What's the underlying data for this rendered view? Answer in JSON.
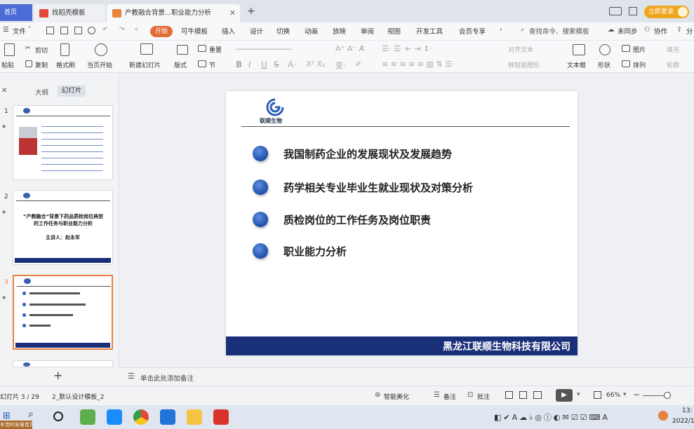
{
  "tabs": {
    "home": "首页",
    "tab1": "找稻壳模板",
    "tab2": "产教融合背景...职业能力分析",
    "new": "+",
    "login": "立即登录"
  },
  "menu": {
    "file": "文件",
    "start": "开始",
    "items": [
      "可牛模板",
      "插入",
      "设计",
      "切换",
      "动画",
      "放映",
      "审阅",
      "视图",
      "开发工具",
      "会员专享"
    ],
    "search": "查找命令、搜索模板",
    "sync": "未同步",
    "collab": "协作",
    "share": "分"
  },
  "ribbon": {
    "paste": "粘贴",
    "cut": "剪切",
    "copy": "复制",
    "format_painter": "格式刷",
    "play_current": "当页开始",
    "new_slide": "新建幻灯片",
    "layout": "版式",
    "section": "节",
    "reset": "重置",
    "align_text": "对齐文本",
    "smart_graphic": "转智能图形",
    "textbox": "文本框",
    "shape": "形状",
    "picture": "图片",
    "arrange": "排列",
    "fill": "填充",
    "outline": "轮廓"
  },
  "sidebar": {
    "outline_tab": "大纲",
    "slides_tab": "幻灯片",
    "add": "+",
    "slide2_title": "“产教融合”背景下药品质检岗位典型的工作任务与职业能力分析",
    "slide2_speaker": "主讲人：赵永军",
    "slide_numbers": [
      "1",
      "2",
      "3"
    ]
  },
  "slide": {
    "logo_text": "联顺生物",
    "bullets": [
      "我国制药企业的发展现状及发展趋势",
      "药学相关专业毕业生就业现状及对策分析",
      "质检岗位的工作任务及岗位职责",
      "职业能力分析"
    ],
    "footer": "黑龙江联顺生物科技有限公司"
  },
  "notes": {
    "placeholder": "单击此处添加备注"
  },
  "status": {
    "slide_counter": "幻灯片 3 / 29",
    "template": "2_默认设计模板_2",
    "beautify": "智能美化",
    "notes_btn": "备注",
    "comments_btn": "批注",
    "zoom": "66%"
  },
  "taskbar": {
    "time": "13:",
    "date": "2022/1",
    "corner_label": "东觉的安居首页"
  },
  "colors": {
    "accent_orange": "#e26c36",
    "wps_blue": "#4d6bd6",
    "footer_navy": "#1a2f7a"
  }
}
